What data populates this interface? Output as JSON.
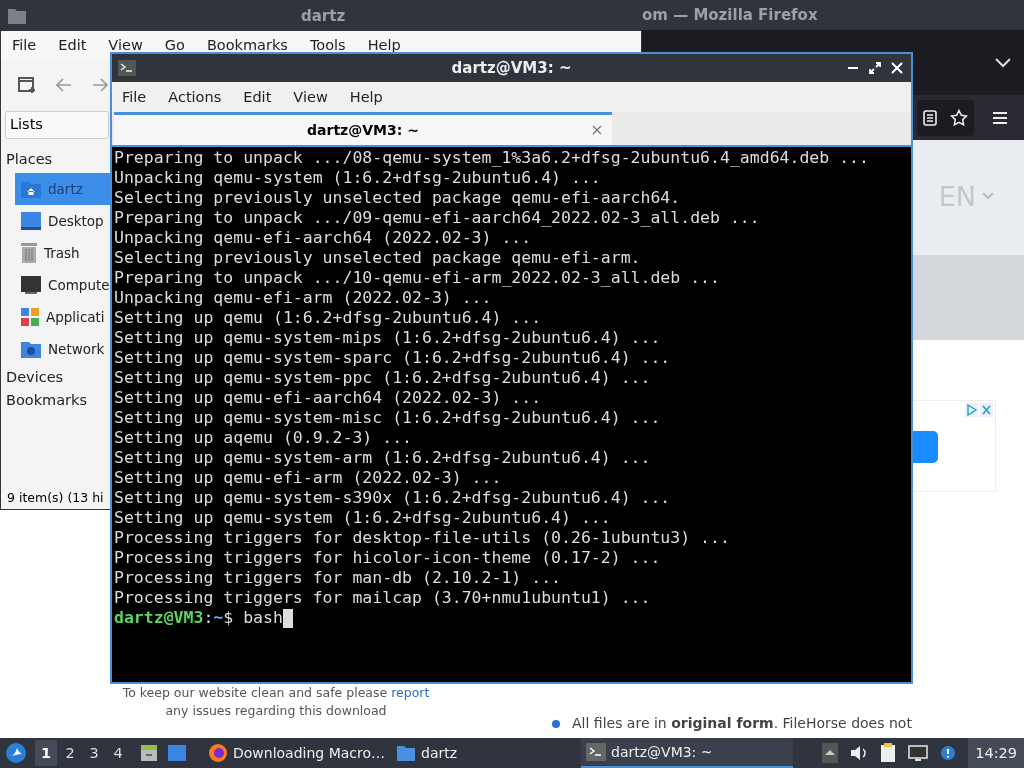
{
  "firefox": {
    "title": "om — Mozilla Firefox",
    "language": "EN",
    "notice": {
      "before": "To keep our website clean and safe please",
      "link": "report",
      "after": "any issues regarding this download"
    },
    "bullet": "All files are in **original form**. FileHorse does not"
  },
  "file_manager": {
    "title": "dartz",
    "menu": [
      "File",
      "Edit",
      "View",
      "Go",
      "Bookmarks",
      "Tools",
      "Help"
    ],
    "view_dropdown": "Lists",
    "places_heading": "Places",
    "places": [
      {
        "label": "dartz",
        "selected": true
      },
      {
        "label": "Desktop",
        "selected": false
      },
      {
        "label": "Trash",
        "selected": false
      },
      {
        "label": "Compute",
        "selected": false
      },
      {
        "label": "Applicati",
        "selected": false
      },
      {
        "label": "Network",
        "selected": false
      }
    ],
    "other_headings": [
      "Devices",
      "Bookmarks"
    ],
    "status": "9 item(s) (13 hi"
  },
  "terminal": {
    "title": "dartz@VM3: ~",
    "menu": [
      "File",
      "Actions",
      "Edit",
      "View",
      "Help"
    ],
    "tabs": [
      {
        "label": "dartz@VM3: ~",
        "selected": true
      }
    ],
    "lines": [
      "Preparing to unpack .../08-qemu-system_1%3a6.2+dfsg-2ubuntu6.4_amd64.deb ...",
      "Unpacking qemu-system (1:6.2+dfsg-2ubuntu6.4) ...",
      "Selecting previously unselected package qemu-efi-aarch64.",
      "Preparing to unpack .../09-qemu-efi-aarch64_2022.02-3_all.deb ...",
      "Unpacking qemu-efi-aarch64 (2022.02-3) ...",
      "Selecting previously unselected package qemu-efi-arm.",
      "Preparing to unpack .../10-qemu-efi-arm_2022.02-3_all.deb ...",
      "Unpacking qemu-efi-arm (2022.02-3) ...",
      "Setting up qemu (1:6.2+dfsg-2ubuntu6.4) ...",
      "Setting up qemu-system-mips (1:6.2+dfsg-2ubuntu6.4) ...",
      "Setting up qemu-system-sparc (1:6.2+dfsg-2ubuntu6.4) ...",
      "Setting up qemu-system-ppc (1:6.2+dfsg-2ubuntu6.4) ...",
      "Setting up qemu-efi-aarch64 (2022.02-3) ...",
      "Setting up qemu-system-misc (1:6.2+dfsg-2ubuntu6.4) ...",
      "Setting up aqemu (0.9.2-3) ...",
      "Setting up qemu-system-arm (1:6.2+dfsg-2ubuntu6.4) ...",
      "Setting up qemu-efi-arm (2022.02-3) ...",
      "Setting up qemu-system-s390x (1:6.2+dfsg-2ubuntu6.4) ...",
      "Setting up qemu-system (1:6.2+dfsg-2ubuntu6.4) ...",
      "Processing triggers for desktop-file-utils (0.26-1ubuntu3) ...",
      "Processing triggers for hicolor-icon-theme (0.17-2) ...",
      "Processing triggers for man-db (2.10.2-1) ...",
      "Processing triggers for mailcap (3.70+nmu1ubuntu1) ..."
    ],
    "prompt": {
      "user_host": "dartz@VM3",
      "separator": ":",
      "path": "~",
      "symbol": "$ ",
      "command": "bash"
    }
  },
  "taskbar": {
    "workspaces": [
      {
        "label": "1",
        "selected": true
      },
      {
        "label": "2",
        "selected": false
      },
      {
        "label": "3",
        "selected": false
      },
      {
        "label": "4",
        "selected": false
      }
    ],
    "tasks": [
      {
        "label": "Downloading Macro…",
        "selected": false
      },
      {
        "label": "dartz",
        "selected": false
      },
      {
        "label": "dartz@VM3: ~",
        "selected": true
      }
    ],
    "clock": "14:29"
  }
}
